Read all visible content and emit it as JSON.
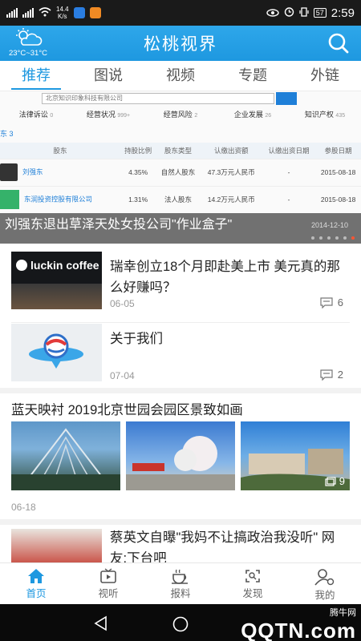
{
  "status_bar": {
    "speed_value": "14.4",
    "speed_unit": "K/s",
    "battery": "57",
    "time": "2:59"
  },
  "header": {
    "title": "松桃视界",
    "weather_temp": "23°C~31°C"
  },
  "tabs": [
    {
      "label": "推荐",
      "active": true
    },
    {
      "label": "图说"
    },
    {
      "label": "视频"
    },
    {
      "label": "专题"
    },
    {
      "label": "外链"
    }
  ],
  "banner": {
    "search_text": "北京知识印象科技有限公司",
    "tabs": [
      {
        "label": "法律诉讼",
        "count": "0"
      },
      {
        "label": "经营状况",
        "count": "999+"
      },
      {
        "label": "经营风险",
        "count": "2"
      },
      {
        "label": "企业发展",
        "count": "26"
      },
      {
        "label": "知识产权",
        "count": "435"
      }
    ],
    "section_label": "东 3",
    "table_headers": [
      "股东",
      "持股比例",
      "股东类型",
      "认缴出资额",
      "认缴出资日期",
      "参股日期"
    ],
    "rows": [
      {
        "name": "刘强东",
        "ratio": "4.35%",
        "type": "自然人股东",
        "amount": "47.3万元人民币",
        "date": "-",
        "join": "2015-08-18"
      },
      {
        "name": "东润投资控股有限公司",
        "ratio": "1.31%",
        "type": "法人股东",
        "amount": "14.2万元人民币",
        "date": "-",
        "join": "2015-08-18"
      }
    ],
    "caption": "刘强东退出草泽天处女投公司\"作业盒子\"",
    "caption_date": "2014-12-10"
  },
  "feed": [
    {
      "title": "瑞幸创立18个月即赴美上市 美元真的那么好赚吗？",
      "date": "06-05",
      "comments": "6",
      "thumb_text": "luckin coffee"
    },
    {
      "title": "关于我们",
      "date": "07-04",
      "comments": "2"
    },
    {
      "title": "蓝天映衬 2019北京世园会园区景致如画",
      "date": "06-18",
      "photo_count": "9"
    },
    {
      "title": "蔡英文自曝\"我妈不让搞政治我没听\" 网友:下台吧"
    }
  ],
  "bottom_nav": [
    {
      "label": "首页",
      "icon": "home-icon",
      "active": true
    },
    {
      "label": "视听",
      "icon": "tv-icon"
    },
    {
      "label": "报料",
      "icon": "cup-icon"
    },
    {
      "label": "发现",
      "icon": "discover-icon"
    },
    {
      "label": "我的",
      "icon": "user-settings-icon"
    }
  ],
  "watermark": {
    "line1": "腾牛网",
    "line2": "QQTN.com"
  },
  "colors": {
    "accent": "#1e98e0",
    "header": "#2ea7ea",
    "dot_active": "#ff5533"
  }
}
